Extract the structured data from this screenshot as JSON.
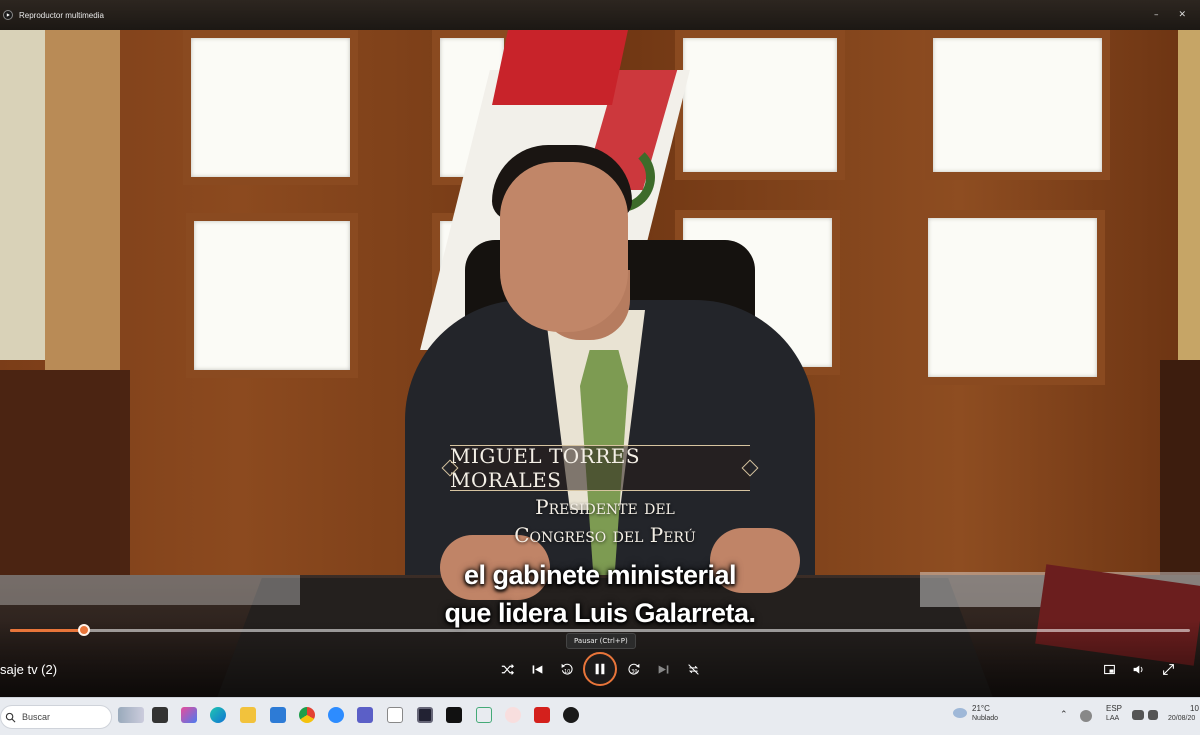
{
  "window": {
    "title": "Reproductor multimedia",
    "minimize_glyph": "–",
    "close_glyph": "✕"
  },
  "video": {
    "name_plate": "MIGUEL TORRES MORALES",
    "role_line1": "Presidente del",
    "role_line2": "Congreso del Perú",
    "subtitle_line1": "el gabinete ministerial",
    "subtitle_line2": "que lidera Luis Galarreta."
  },
  "player": {
    "media_title": "saje tv (2)",
    "progress": 0.063,
    "tooltip": "Pausar (Ctrl+P)",
    "skip_back_label": "10",
    "skip_forward_label": "30",
    "accent_color": "#e8753a",
    "controls": [
      "shuffle-icon",
      "previous-icon",
      "skip-back-10-icon",
      "pause-icon",
      "skip-forward-30-icon",
      "next-icon",
      "repeat-off-icon"
    ],
    "right_controls": [
      "miniplayer-icon",
      "volume-icon",
      "fullscreen-icon"
    ]
  },
  "taskbar": {
    "search_placeholder": "Buscar",
    "weather_temp": "21°C",
    "weather_desc": "Nublado",
    "language": "ESP",
    "language_sub": "LAA",
    "time": "10",
    "date": "20/08/20",
    "apps": [
      "edge-browser-icon",
      "file-explorer-icon",
      "store-icon",
      "chrome-icon",
      "zoom-icon",
      "teams-icon",
      "media-app-icon",
      "ndi-icon",
      "photos-icon",
      "acrobat-icon",
      "media-player-icon"
    ]
  }
}
